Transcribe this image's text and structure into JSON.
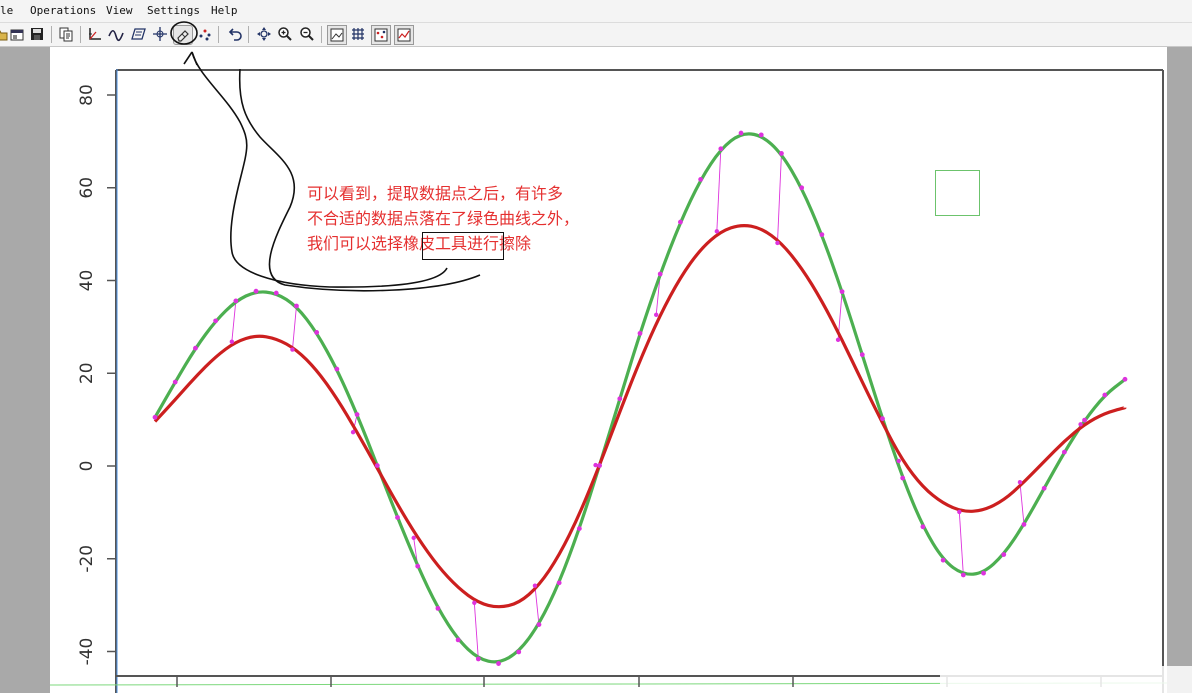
{
  "menu": {
    "items": [
      "le",
      "Operations",
      "View",
      "Settings",
      "Help"
    ]
  },
  "toolbar": {
    "icons": [
      "open-icon",
      "save-icon",
      "copy-icon",
      "axes-icon",
      "curve-icon",
      "segment-fill-icon",
      "point-match-icon",
      "eraser-icon",
      "scatter-points-icon",
      "undo-icon",
      "move-icon",
      "zoom-in-icon",
      "zoom-out-icon",
      "image-view-icon",
      "grid-icon",
      "points-view-icon",
      "curve-view-icon"
    ]
  },
  "annotation": {
    "line1": "可以看到，提取数据点之后，有许多",
    "line2": "不合适的数据点落在了绿色曲线之外，",
    "line3_pre": "我们可以选择",
    "line3_highlight": "橡皮工具",
    "line3_post": "进行擦除"
  },
  "colors": {
    "green_curve": "#4caf50",
    "red_curve": "#cc1f1f",
    "points": "#dd33dd",
    "annotation_text": "#e53030"
  },
  "chart_data": {
    "type": "line",
    "ylim": [
      -45,
      82
    ],
    "yticks": [
      80,
      60,
      40,
      20,
      0,
      -20,
      -40
    ],
    "x": [
      0,
      0.25,
      0.5,
      0.75,
      1,
      1.25,
      1.5,
      1.75,
      2,
      2.25,
      2.5,
      2.75,
      3,
      3.25,
      3.5,
      3.75,
      4,
      4.25,
      4.5,
      4.75,
      5,
      5.25,
      5.5,
      5.75,
      6,
      6.25,
      6.5,
      6.75,
      7,
      7.25,
      7.5,
      7.75,
      8,
      8.25,
      8.5,
      8.75,
      9,
      9.25,
      9.5,
      9.75,
      10,
      10.25,
      10.5,
      10.75,
      11,
      11.25,
      11.5,
      11.75,
      12
    ],
    "series": [
      {
        "color": "#4caf50",
        "values": [
          10.5,
          18.1,
          25.4,
          31.3,
          35.6,
          37.7,
          37.3,
          34.5,
          28.8,
          20.9,
          11.1,
          0.1,
          -11.1,
          -21.6,
          -30.7,
          -37.5,
          -41.6,
          -42.6,
          -40.1,
          -34.2,
          -25.2,
          -13.5,
          0.1,
          14.5,
          28.6,
          41.4,
          52.6,
          61.8,
          68.4,
          71.8,
          71.4,
          67.4,
          60.0,
          49.9,
          37.6,
          24.0,
          10.2,
          -2.6,
          -13.1,
          -20.3,
          -23.5,
          -23.1,
          -19.1,
          -12.6,
          -4.8,
          3.0,
          9.9,
          15.3,
          18.7
        ]
      },
      {
        "color": "#cc1f1f",
        "values": [
          9.6,
          14.3,
          19.2,
          23.6,
          26.8,
          28.2,
          27.5,
          25.1,
          20.7,
          14.6,
          7.3,
          -0.5,
          -8.3,
          -15.5,
          -21.6,
          -26.3,
          -29.5,
          -30.6,
          -29.6,
          -25.8,
          -19.3,
          -10.5,
          0.2,
          11.7,
          22.8,
          32.6,
          40.7,
          46.8,
          50.6,
          52.1,
          51.3,
          48.1,
          42.7,
          35.6,
          27.2,
          18.1,
          9.2,
          1.1,
          -4.6,
          -8.1,
          -9.9,
          -9.6,
          -7.4,
          -3.5,
          1.0,
          5.4,
          9.0,
          11.4,
          12.6
        ]
      }
    ]
  }
}
